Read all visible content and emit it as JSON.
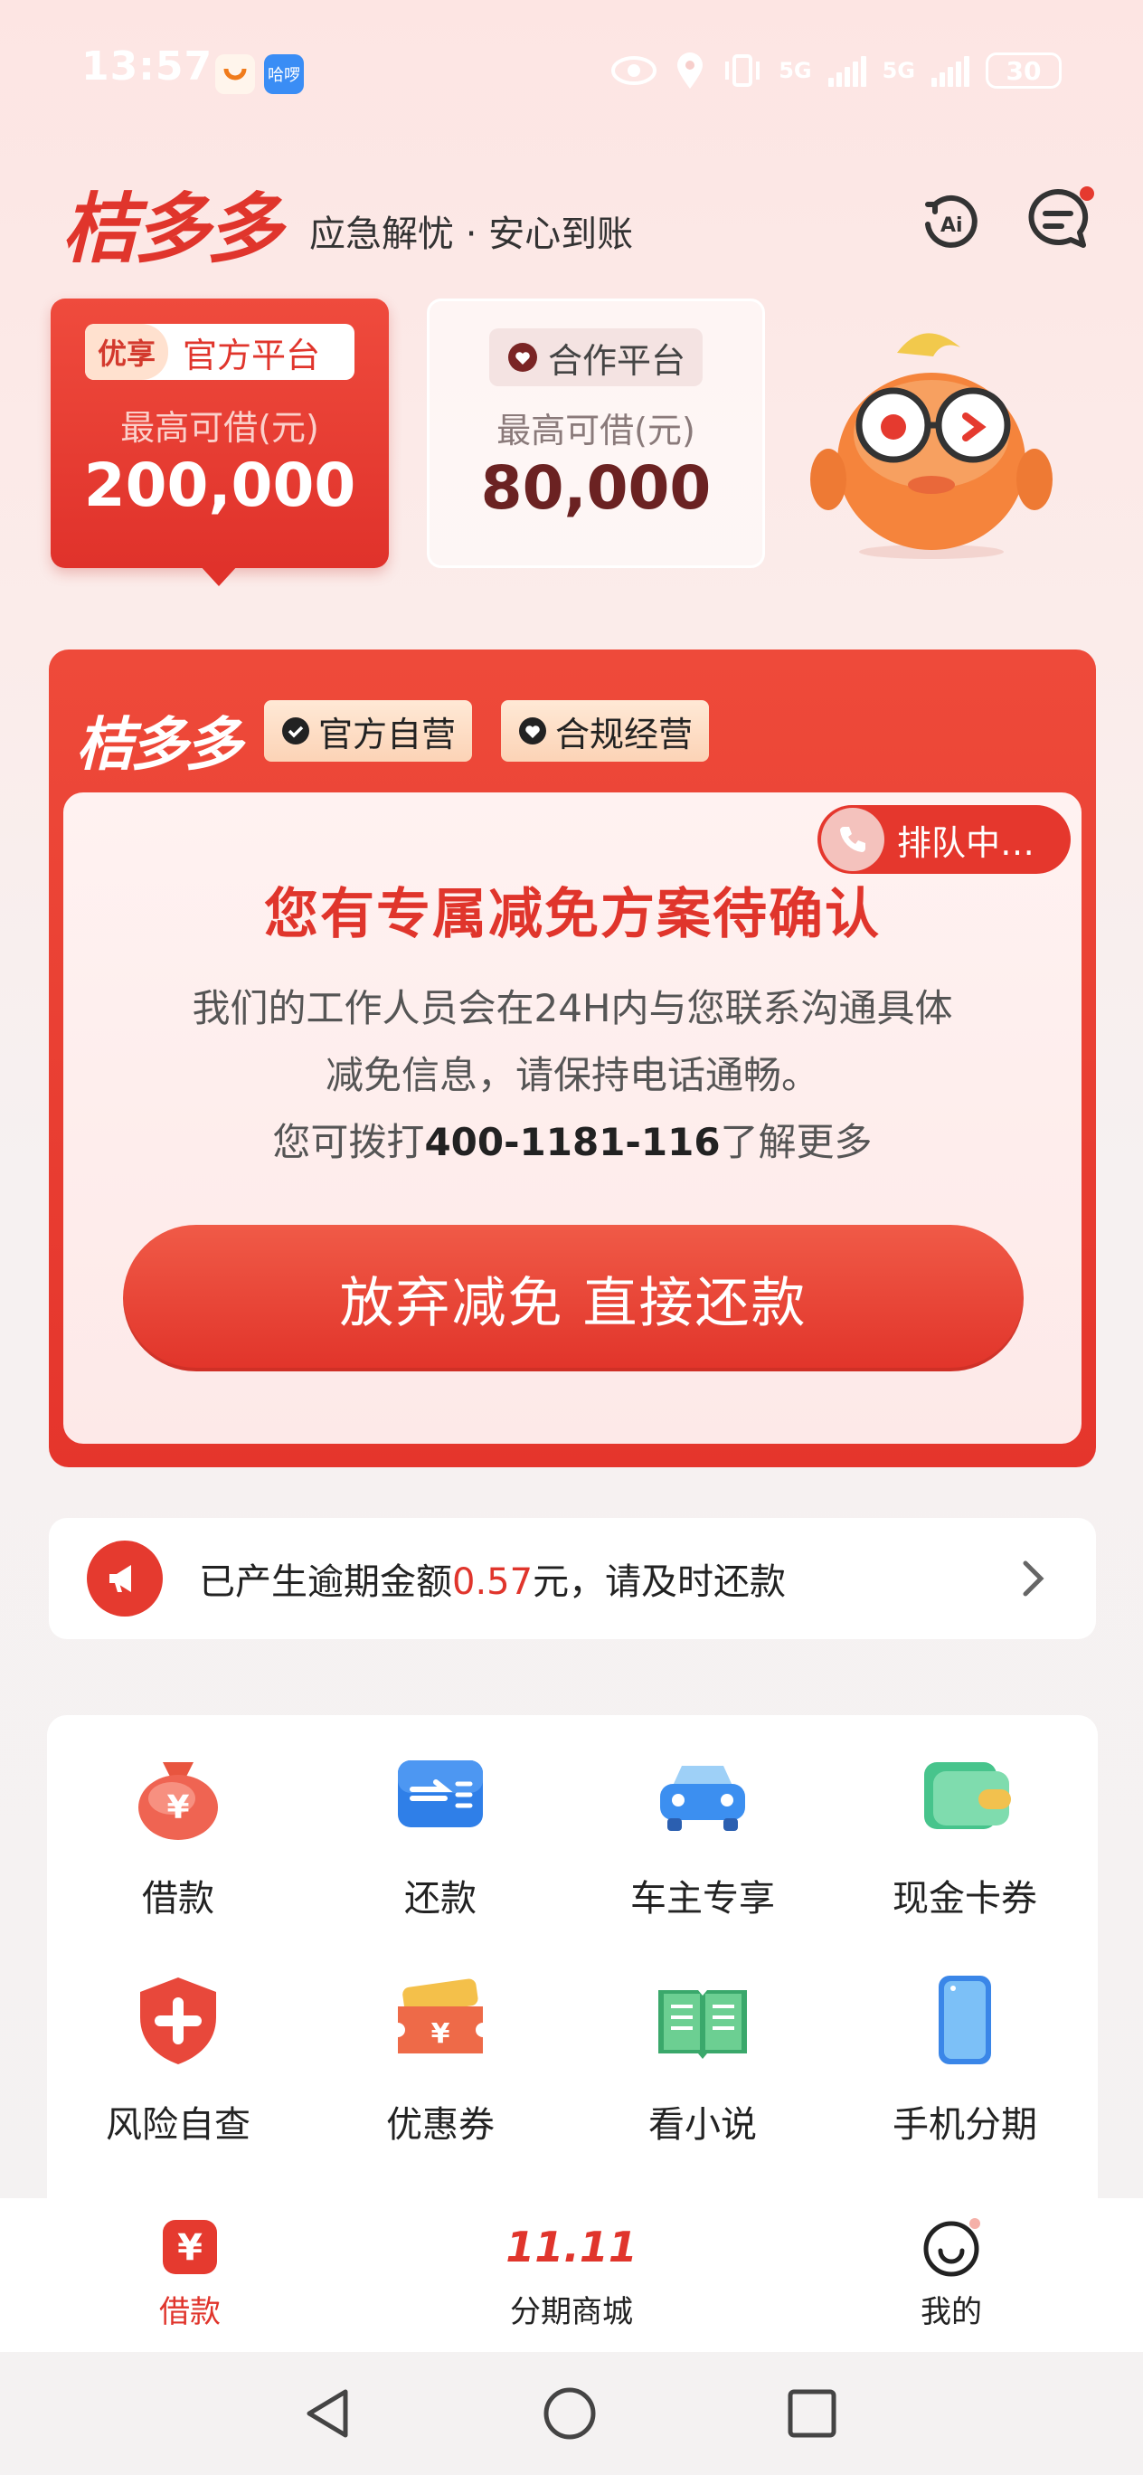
{
  "status_bar": {
    "time": "13:57",
    "app_icon_badge": "哈啰",
    "network_1": "5G",
    "network_2": "5G",
    "battery": "30"
  },
  "header": {
    "logo": "桔多多",
    "slogan": "应急解忧 · 安心到账"
  },
  "platforms": [
    {
      "badge": "优享",
      "name": "官方平台",
      "label": "最高可借(元)",
      "amount": "200,000"
    },
    {
      "name": "合作平台",
      "label": "最高可借(元)",
      "amount": "80,000"
    }
  ],
  "relief": {
    "logo": "桔多多",
    "tag_official": "官方自营",
    "tag_compliant": "合规经营",
    "queue": "排队中…",
    "title": "您有专属减免方案待确认",
    "desc_line1": "我们的工作人员会在24H内与您联系沟通具体",
    "desc_line2": "减免信息，请保持电话通畅。",
    "desc_line3_prefix": "您可拨打",
    "phone": "400-1181-116",
    "desc_line3_suffix": "了解更多",
    "cta": "放弃减免 直接还款"
  },
  "notice": {
    "prefix": "已产生逾期金额",
    "amount": "0.57",
    "suffix": "元，请及时还款"
  },
  "services": [
    {
      "label": "借款",
      "icon": "money-bag-icon"
    },
    {
      "label": "还款",
      "icon": "repay-card-icon"
    },
    {
      "label": "车主专享",
      "icon": "car-icon"
    },
    {
      "label": "现金卡券",
      "icon": "wallet-icon"
    },
    {
      "label": "风险自查",
      "icon": "shield-plus-icon"
    },
    {
      "label": "优惠券",
      "icon": "coupon-icon"
    },
    {
      "label": "看小说",
      "icon": "book-icon"
    },
    {
      "label": "手机分期",
      "icon": "phone-icon"
    }
  ],
  "bottom_nav": [
    {
      "label": "借款",
      "active": true
    },
    {
      "label": "分期商城",
      "badge": "11.11"
    },
    {
      "label": "我的"
    }
  ],
  "colors": {
    "brand_red": "#e0352c",
    "cta_red": "#e1342a"
  }
}
